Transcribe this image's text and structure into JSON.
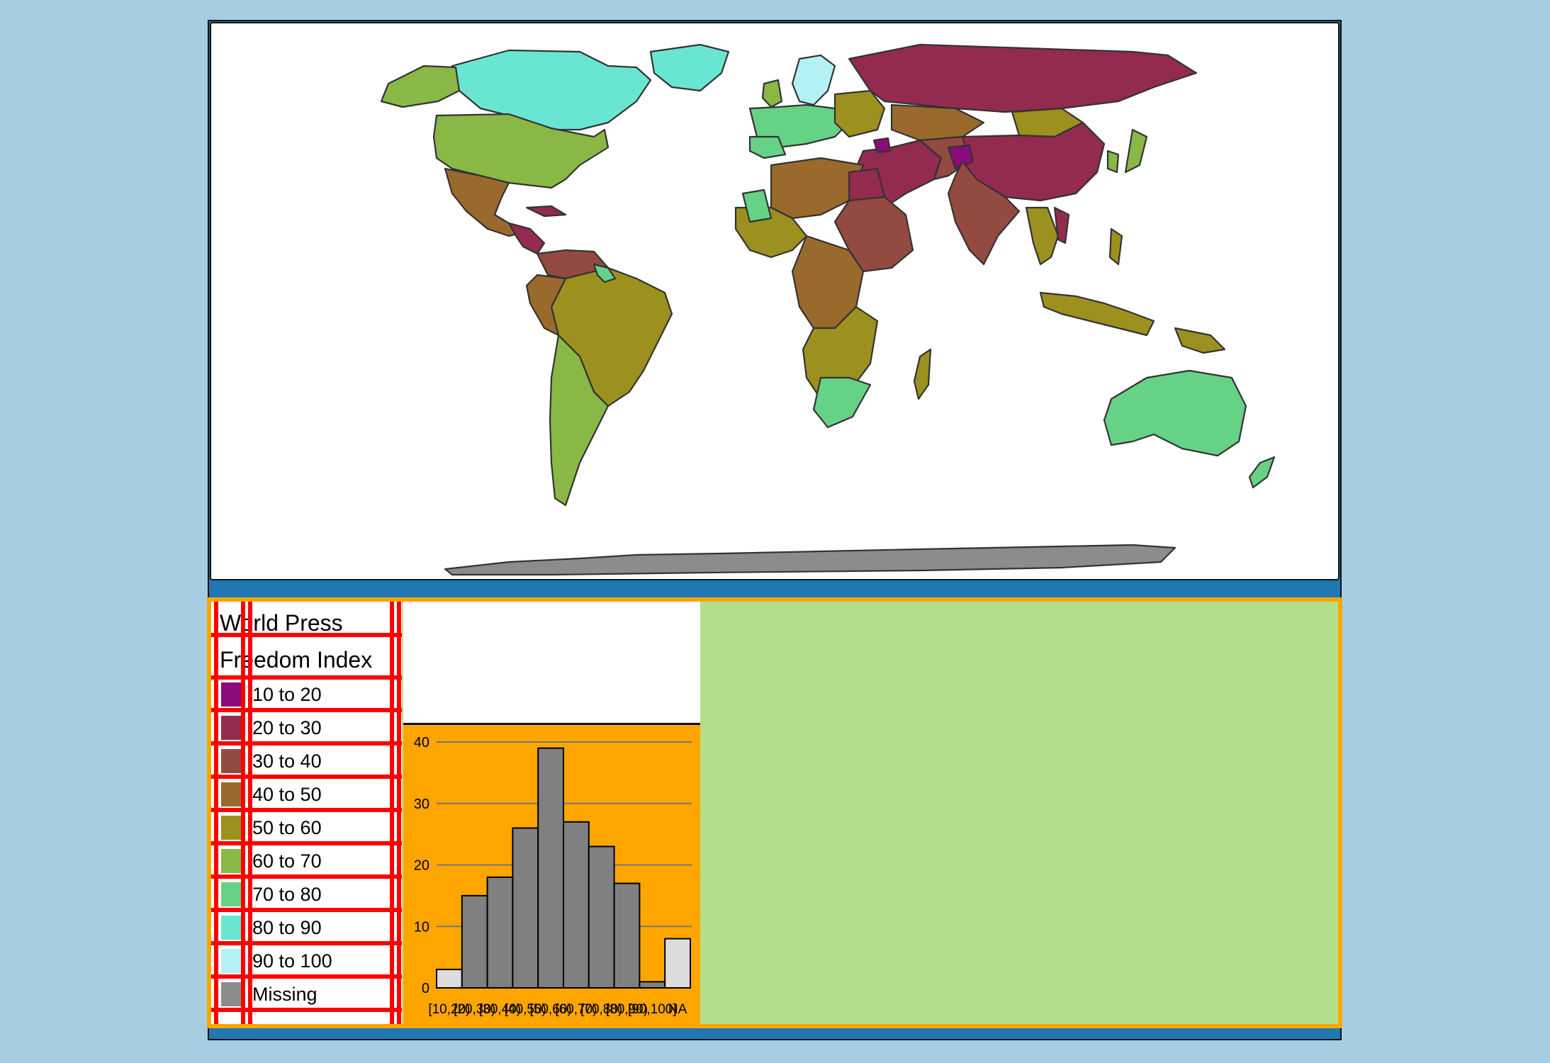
{
  "legend": {
    "title_line1": "World Press",
    "title_line2": "Freedom Index",
    "items": [
      {
        "label": "10 to 20",
        "color": "#8b0a7c"
      },
      {
        "label": "20 to 30",
        "color": "#932a50"
      },
      {
        "label": "30 to 40",
        "color": "#934a40"
      },
      {
        "label": "40 to 50",
        "color": "#996a2c"
      },
      {
        "label": "50 to 60",
        "color": "#9c901e"
      },
      {
        "label": "60 to 70",
        "color": "#89b846"
      },
      {
        "label": "70 to 80",
        "color": "#66d286"
      },
      {
        "label": "80 to 90",
        "color": "#69e6d2"
      },
      {
        "label": "90 to 100",
        "color": "#b4f1f4"
      },
      {
        "label": "Missing",
        "color": "#8c8c8c"
      }
    ]
  },
  "colors": {
    "page_background": "#a6cde2",
    "frame": "#1f78b4",
    "legend_border": "#ffa500",
    "legend_panel": "#b3df8a",
    "antarctica": "#8c8c8c",
    "guides": "#ff0000"
  },
  "chart_data": {
    "type": "bar",
    "categories": [
      "[10,20)",
      "[20,30)",
      "[30,40)",
      "[40,50)",
      "[50,60)",
      "[60,70)",
      "[70,80)",
      "[80,90)",
      "[90,100]",
      "NA"
    ],
    "values": [
      3,
      15,
      18,
      26,
      39,
      27,
      23,
      17,
      1,
      8
    ],
    "yticks": [
      0,
      10,
      20,
      30,
      40
    ],
    "ylim": [
      0,
      40
    ],
    "bar_colors": [
      "#dcdcdc",
      "#808080",
      "#808080",
      "#808080",
      "#808080",
      "#808080",
      "#808080",
      "#808080",
      "#808080",
      "#dcdcdc"
    ],
    "grid": true
  }
}
